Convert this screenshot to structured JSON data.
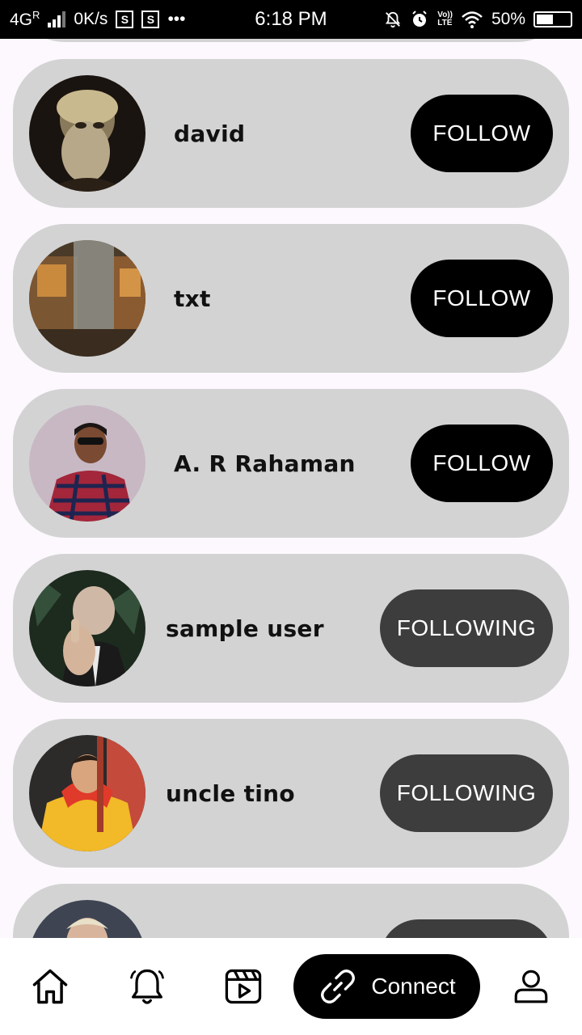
{
  "status_bar": {
    "network": "4G",
    "network_flag": "R",
    "speed": "0K/s",
    "time": "6:18 PM",
    "battery": "50%",
    "battery_level": 0.5,
    "lte_top": "Vo))",
    "lte_bottom": "LTE",
    "sim_badge": "S",
    "more": "•••"
  },
  "users": [
    {
      "name": "david",
      "button": "FOLLOW",
      "following": false
    },
    {
      "name": "txt",
      "button": "FOLLOW",
      "following": false
    },
    {
      "name": "A. R Rahaman",
      "button": "FOLLOW",
      "following": false
    },
    {
      "name": "sample user",
      "button": "FOLLOWING",
      "following": true
    },
    {
      "name": "uncle tino",
      "button": "FOLLOWING",
      "following": true
    },
    {
      "name": "",
      "button": "",
      "following": true
    }
  ],
  "bottom_nav": {
    "items": [
      {
        "icon": "home-icon"
      },
      {
        "icon": "bell-icon"
      },
      {
        "icon": "video-icon"
      },
      {
        "icon": "link-icon",
        "label": "Connect",
        "active": true
      },
      {
        "icon": "profile-icon"
      }
    ]
  }
}
